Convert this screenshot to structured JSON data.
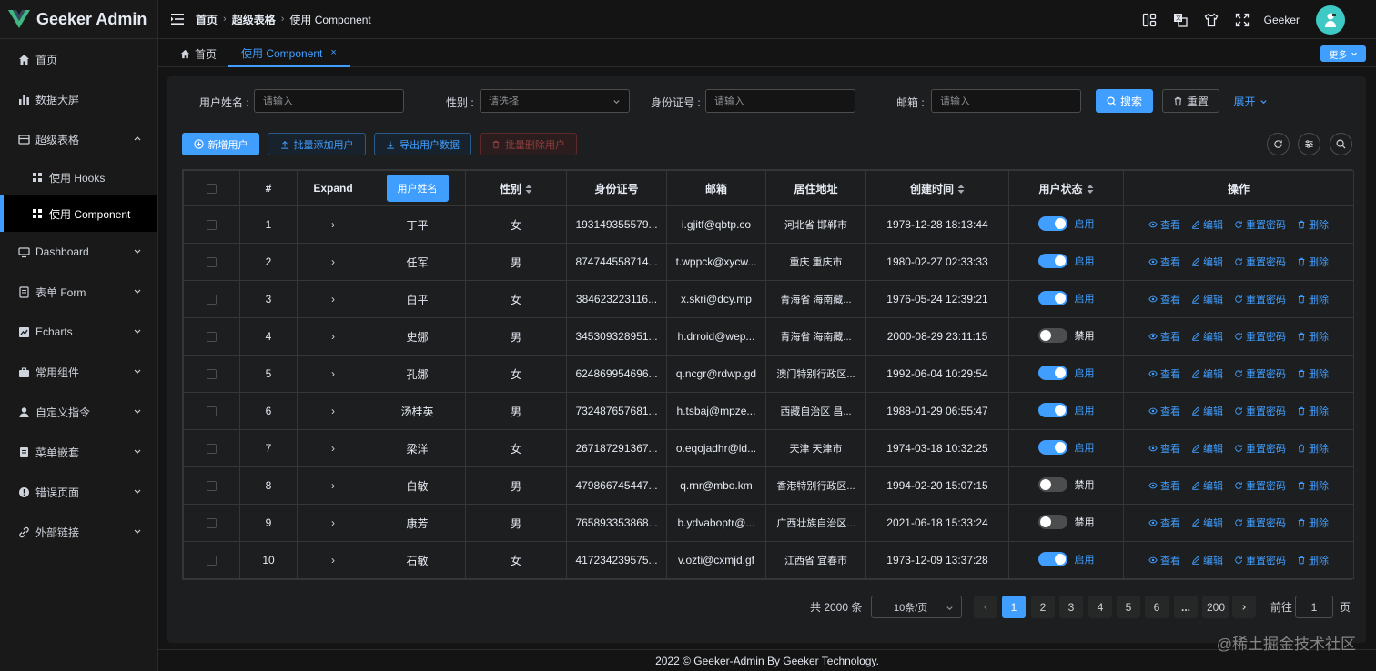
{
  "app": {
    "title": "Geeker Admin",
    "brand_color": "#409eff"
  },
  "sidebar": {
    "items": [
      {
        "label": "首页",
        "icon": "home-icon"
      },
      {
        "label": "数据大屏",
        "icon": "chart-bars-icon"
      },
      {
        "label": "超级表格",
        "icon": "table-icon",
        "expanded": true,
        "children": [
          {
            "label": "使用 Hooks",
            "icon": "grid-icon"
          },
          {
            "label": "使用 Component",
            "icon": "grid-icon",
            "active": true
          }
        ]
      },
      {
        "label": "Dashboard",
        "icon": "monitor-icon"
      },
      {
        "label": "表单 Form",
        "icon": "form-icon"
      },
      {
        "label": "Echarts",
        "icon": "line-chart-icon"
      },
      {
        "label": "常用组件",
        "icon": "briefcase-icon"
      },
      {
        "label": "自定义指令",
        "icon": "user-icon"
      },
      {
        "label": "菜单嵌套",
        "icon": "list-icon"
      },
      {
        "label": "错误页面",
        "icon": "warning-icon"
      },
      {
        "label": "外部链接",
        "icon": "link-icon"
      }
    ]
  },
  "header": {
    "breadcrumb": [
      "首页",
      "超级表格",
      "使用 Component"
    ],
    "username": "Geeker"
  },
  "tabs": {
    "items": [
      {
        "label": "首页"
      },
      {
        "label": "使用 Component",
        "active": true
      }
    ],
    "more_label": "更多"
  },
  "search": {
    "name_label": "用户姓名 :",
    "name_placeholder": "请输入",
    "gender_label": "性别 :",
    "gender_placeholder": "请选择",
    "id_label": "身份证号 :",
    "id_placeholder": "请输入",
    "email_label": "邮箱 :",
    "email_placeholder": "请输入",
    "search_btn": "搜索",
    "reset_btn": "重置",
    "expand_btn": "展开"
  },
  "toolbar": {
    "add": "新增用户",
    "batch_add": "批量添加用户",
    "export": "导出用户数据",
    "batch_delete": "批量删除用户"
  },
  "table": {
    "columns": [
      "#",
      "Expand",
      "用户姓名",
      "性别",
      "身份证号",
      "邮箱",
      "居住地址",
      "创建时间",
      "用户状态",
      "操作"
    ],
    "actions": [
      "查看",
      "编辑",
      "重置密码",
      "删除"
    ],
    "rows": [
      {
        "idx": "1",
        "name": "丁平",
        "gender": "女",
        "id": "193149355579...",
        "email": "i.gjitf@qbtp.co",
        "addr": "河北省 邯郸市",
        "time": "1978-12-28 18:13:44",
        "status": "启用",
        "on": true
      },
      {
        "idx": "2",
        "name": "任军",
        "gender": "男",
        "id": "874744558714...",
        "email": "t.wppck@xycw...",
        "addr": "重庆 重庆市",
        "time": "1980-02-27 02:33:33",
        "status": "启用",
        "on": true
      },
      {
        "idx": "3",
        "name": "白平",
        "gender": "女",
        "id": "384623223116...",
        "email": "x.skri@dcy.mp",
        "addr": "青海省 海南藏...",
        "time": "1976-05-24 12:39:21",
        "status": "启用",
        "on": true
      },
      {
        "idx": "4",
        "name": "史娜",
        "gender": "男",
        "id": "345309328951...",
        "email": "h.drroid@wep...",
        "addr": "青海省 海南藏...",
        "time": "2000-08-29 23:11:15",
        "status": "禁用",
        "on": false
      },
      {
        "idx": "5",
        "name": "孔娜",
        "gender": "女",
        "id": "624869954696...",
        "email": "q.ncgr@rdwp.gd",
        "addr": "澳门特别行政区...",
        "time": "1992-06-04 10:29:54",
        "status": "启用",
        "on": true
      },
      {
        "idx": "6",
        "name": "汤桂英",
        "gender": "男",
        "id": "732487657681...",
        "email": "h.tsbaj@mpze...",
        "addr": "西藏自治区 昌...",
        "time": "1988-01-29 06:55:47",
        "status": "启用",
        "on": true
      },
      {
        "idx": "7",
        "name": "梁洋",
        "gender": "女",
        "id": "267187291367...",
        "email": "o.eqojadhr@ld...",
        "addr": "天津 天津市",
        "time": "1974-03-18 10:32:25",
        "status": "启用",
        "on": true
      },
      {
        "idx": "8",
        "name": "白敏",
        "gender": "男",
        "id": "479866745447...",
        "email": "q.rnr@mbo.km",
        "addr": "香港特别行政区...",
        "time": "1994-02-20 15:07:15",
        "status": "禁用",
        "on": false
      },
      {
        "idx": "9",
        "name": "康芳",
        "gender": "男",
        "id": "765893353868...",
        "email": "b.ydvaboptr@...",
        "addr": "广西壮族自治区...",
        "time": "2021-06-18 15:33:24",
        "status": "禁用",
        "on": false
      },
      {
        "idx": "10",
        "name": "石敏",
        "gender": "女",
        "id": "417234239575...",
        "email": "v.ozti@cxmjd.gf",
        "addr": "江西省 宜春市",
        "time": "1973-12-09 13:37:28",
        "status": "启用",
        "on": true
      }
    ]
  },
  "pagination": {
    "total": "共 2000 条",
    "page_size": "10条/页",
    "pages": [
      "1",
      "2",
      "3",
      "4",
      "5",
      "6",
      "...",
      "200"
    ],
    "current": "1",
    "goto_label": "前往",
    "goto_value": "1",
    "page_unit": "页"
  },
  "footer": {
    "text": "2022 © Geeker-Admin By Geeker Technology."
  },
  "watermark": "@稀土掘金技术社区"
}
